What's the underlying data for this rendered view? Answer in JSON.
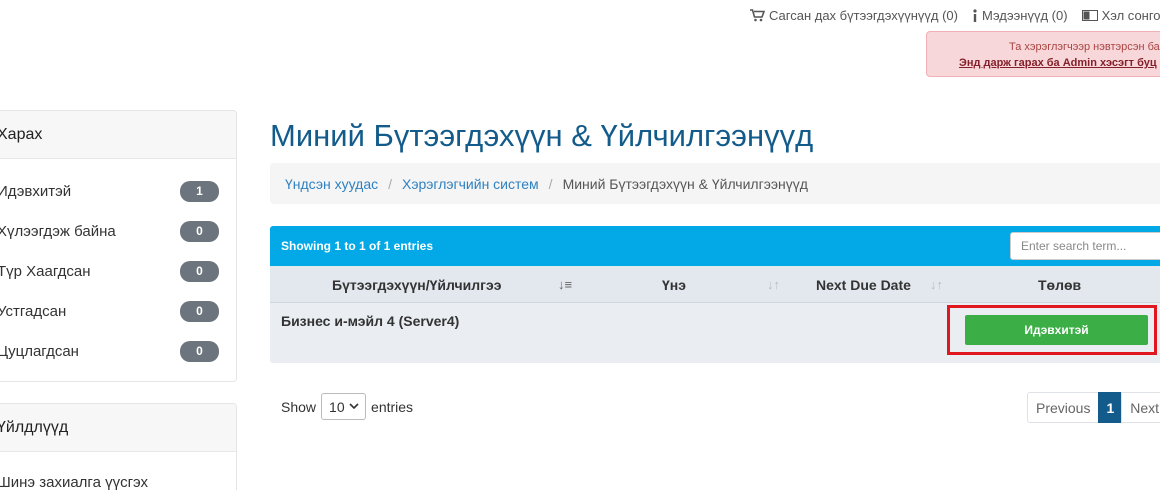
{
  "topbar": {
    "cart_label": "Сагсан дах бүтээгдэхүүнүүд (0)",
    "notifications_label": "Мэдээнүүд (0)",
    "language_label": "Хэл сонго"
  },
  "alert": {
    "line1": "Та хэрэглэгчээр нэвтэрсэн бай",
    "line2": "Энд дарж гарах ба Admin хэсэгт буц"
  },
  "sidebar": {
    "view": {
      "heading": "Харах",
      "items": [
        {
          "label": "Идэвхитэй",
          "count": "1"
        },
        {
          "label": "Хүлээгдэж байна",
          "count": "0"
        },
        {
          "label": "Түр Хаагдсан",
          "count": "0"
        },
        {
          "label": "Устгадсан",
          "count": "0"
        },
        {
          "label": "Цуцлагдсан",
          "count": "0"
        }
      ]
    },
    "actions": {
      "heading": "Үйлдлүүд",
      "items": [
        {
          "label": "Шинэ захиалга үүсгэх"
        }
      ]
    }
  },
  "main": {
    "title": "Миний Бүтээгдэхүүн & Үйлчилгээнүүд",
    "breadcrumb": {
      "home": "Үндсэн хуудас",
      "client_area": "Хэрэглэгчийн систем",
      "current": "Миний Бүтээгдэхүүн & Үйлчилгээнүүд"
    },
    "table": {
      "info": "Showing 1 to 1 of 1 entries",
      "search_placeholder": "Enter search term...",
      "columns": [
        "Бүтээгдэхүүн/Үйлчилгээ",
        "Үнэ",
        "Next Due Date",
        "Төлөв"
      ],
      "rows": [
        {
          "product": "Бизнес и-мэйл 4 (Server4)",
          "price": "",
          "next_due": "",
          "status": "Идэвхитэй"
        }
      ]
    },
    "length": {
      "show_label": "Show",
      "value": "10",
      "entries_label": "entries"
    },
    "pagination": {
      "previous": "Previous",
      "current": "1",
      "next": "Next"
    }
  },
  "colors": {
    "table_header": "#02a9e6",
    "status_active": "#3bae46",
    "title": "#135b8a",
    "highlight": "#e0171f"
  }
}
